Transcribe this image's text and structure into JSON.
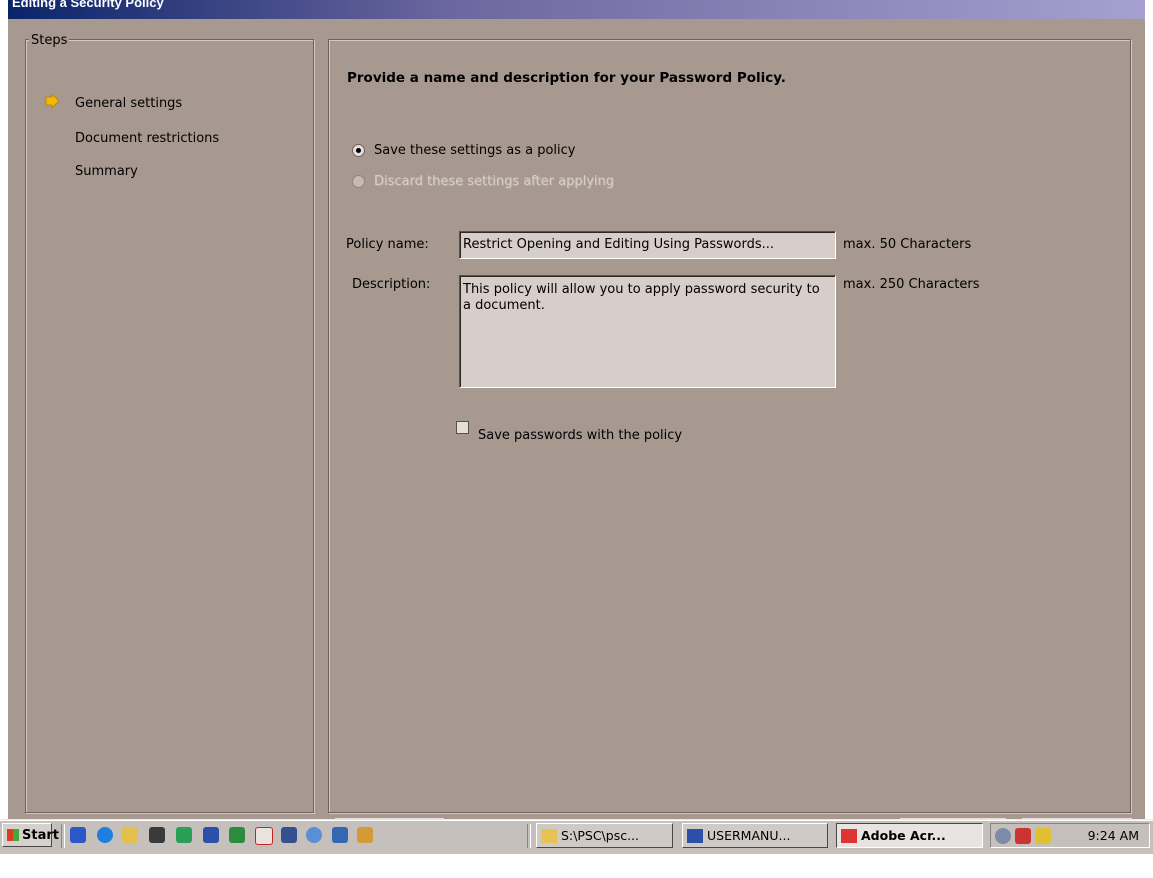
{
  "window": {
    "title": "Editing a Security Policy"
  },
  "steps": {
    "legend": "Steps",
    "items": [
      "General settings",
      "Document restrictions",
      "Summary"
    ]
  },
  "main": {
    "heading": "Provide a name and description for your Password Policy.",
    "radio_save": "Save these settings as a policy",
    "radio_discard": "Discard these settings after applying",
    "policy_name_label": "Policy name:",
    "policy_name_value": "Restrict Opening and Editing Using Passwords...",
    "policy_name_hint": "max. 50 Characters",
    "description_label": "Description:",
    "description_value": "This policy will allow you to apply password security to a document.",
    "description_hint": "max. 250 Characters",
    "save_passwords_label": "Save passwords with the policy"
  },
  "taskbar": {
    "start": "Start",
    "tasks": [
      "S:\\PSC\\psc...",
      "USERMANU...",
      "Adobe Acr..."
    ],
    "clock": "9:24 AM"
  },
  "colors": {
    "dialog_bg": "#a89990",
    "title_start": "#0a246a",
    "title_end": "#a6a0d0",
    "taskbar": "#c5c0bb"
  }
}
